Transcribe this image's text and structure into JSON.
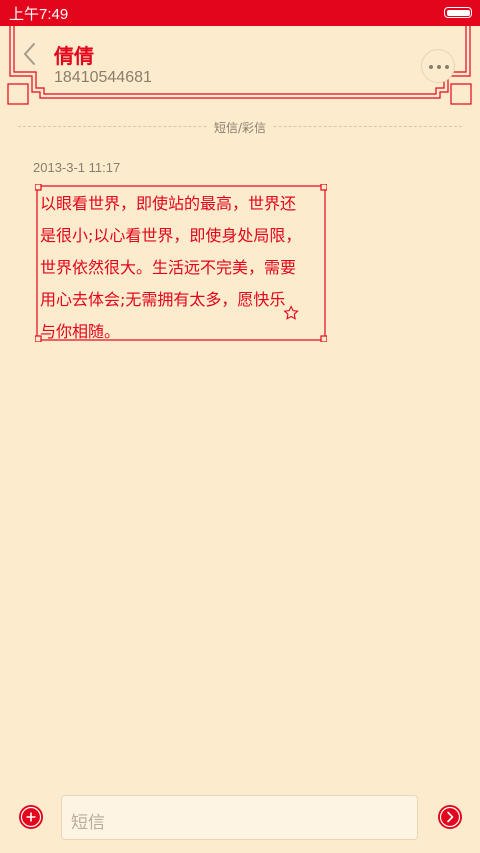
{
  "status_bar": {
    "time": "上午7:49",
    "battery_icon": "battery-full-icon"
  },
  "header": {
    "contact_name": "倩倩",
    "phone_number": "18410544681",
    "back_icon": "chevron-left-icon",
    "more_icon": "more-horizontal-icon"
  },
  "thread": {
    "divider_label": "短信/彩信",
    "messages": [
      {
        "timestamp": "2013-3-1 11:17",
        "lines": [
          "以眼看世界，即使站的最高，世界还",
          "是很小;以心看世界，即使身处局限，",
          "世界依然很大。生活远不完美，需要",
          "用心去体会;无需拥有太多，愿快乐",
          "与你相随。"
        ]
      }
    ]
  },
  "composer": {
    "placeholder": "短信",
    "add_icon": "plus-circle-icon",
    "send_icon": "send-arrow-icon"
  },
  "colors": {
    "accent": "#e3051c",
    "background": "#fcebcc",
    "muted_text": "#8a7e6e"
  }
}
